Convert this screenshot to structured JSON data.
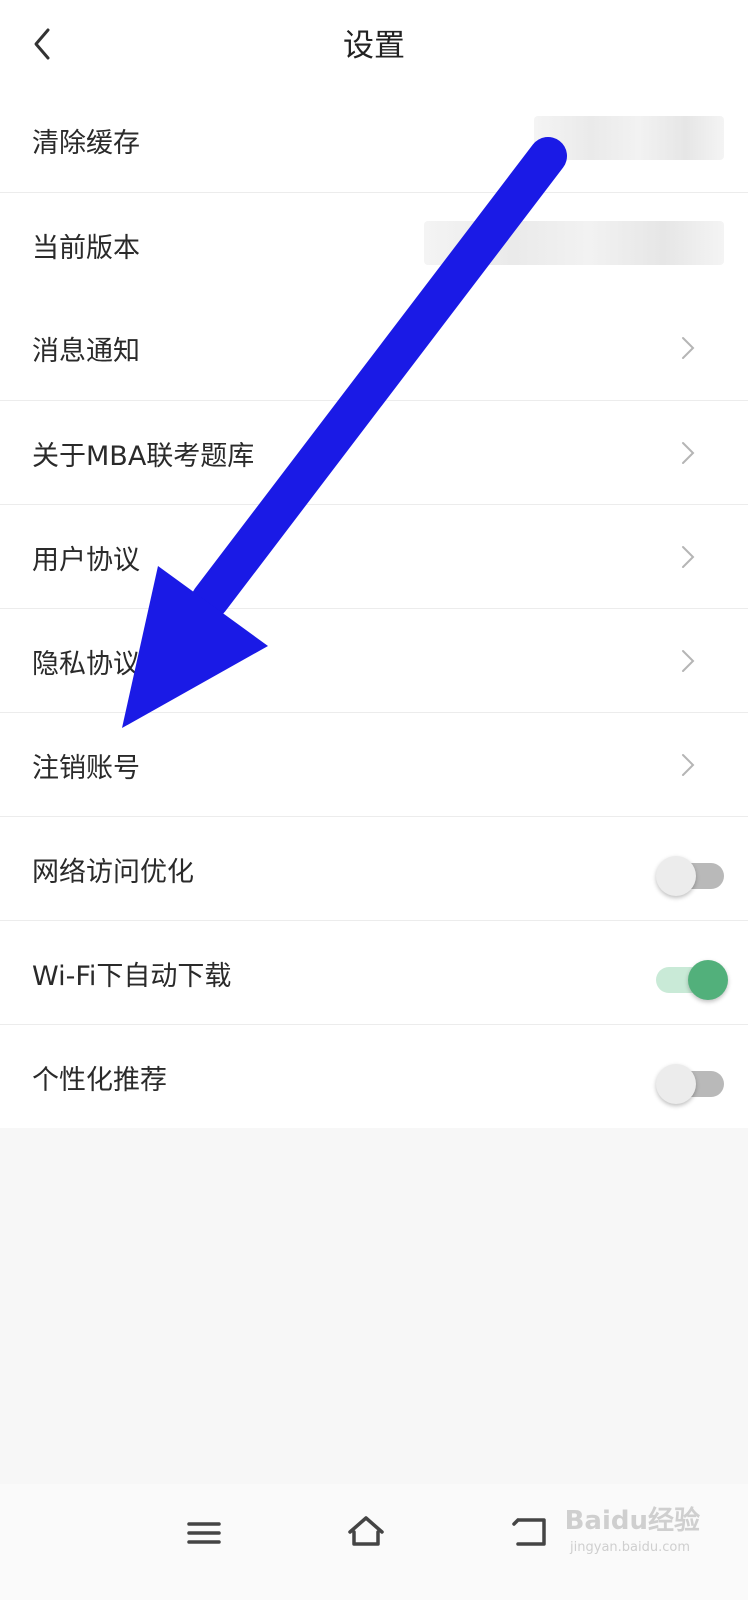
{
  "header": {
    "title": "设置"
  },
  "group1": [
    {
      "label": "清除缓存"
    },
    {
      "label": "当前版本"
    }
  ],
  "group2": [
    {
      "label": "消息通知",
      "control": "chevron"
    },
    {
      "label": "关于MBA联考题库",
      "control": "chevron"
    },
    {
      "label": "用户协议",
      "control": "chevron"
    },
    {
      "label": "隐私协议",
      "control": "chevron"
    },
    {
      "label": "注销账号",
      "control": "chevron"
    },
    {
      "label": "网络访问优化",
      "control": "toggle",
      "state": "off"
    },
    {
      "label": "Wi-Fi下自动下载",
      "control": "toggle",
      "state": "on"
    },
    {
      "label": "个性化推荐",
      "control": "toggle",
      "state": "off"
    }
  ],
  "colors": {
    "arrow": "#1a1ae6",
    "toggle_on": "#52b07b",
    "toggle_off_track": "#b9b9b9"
  },
  "watermark": {
    "brand": "Baidu经验",
    "url": "jingyan.baidu.com"
  }
}
